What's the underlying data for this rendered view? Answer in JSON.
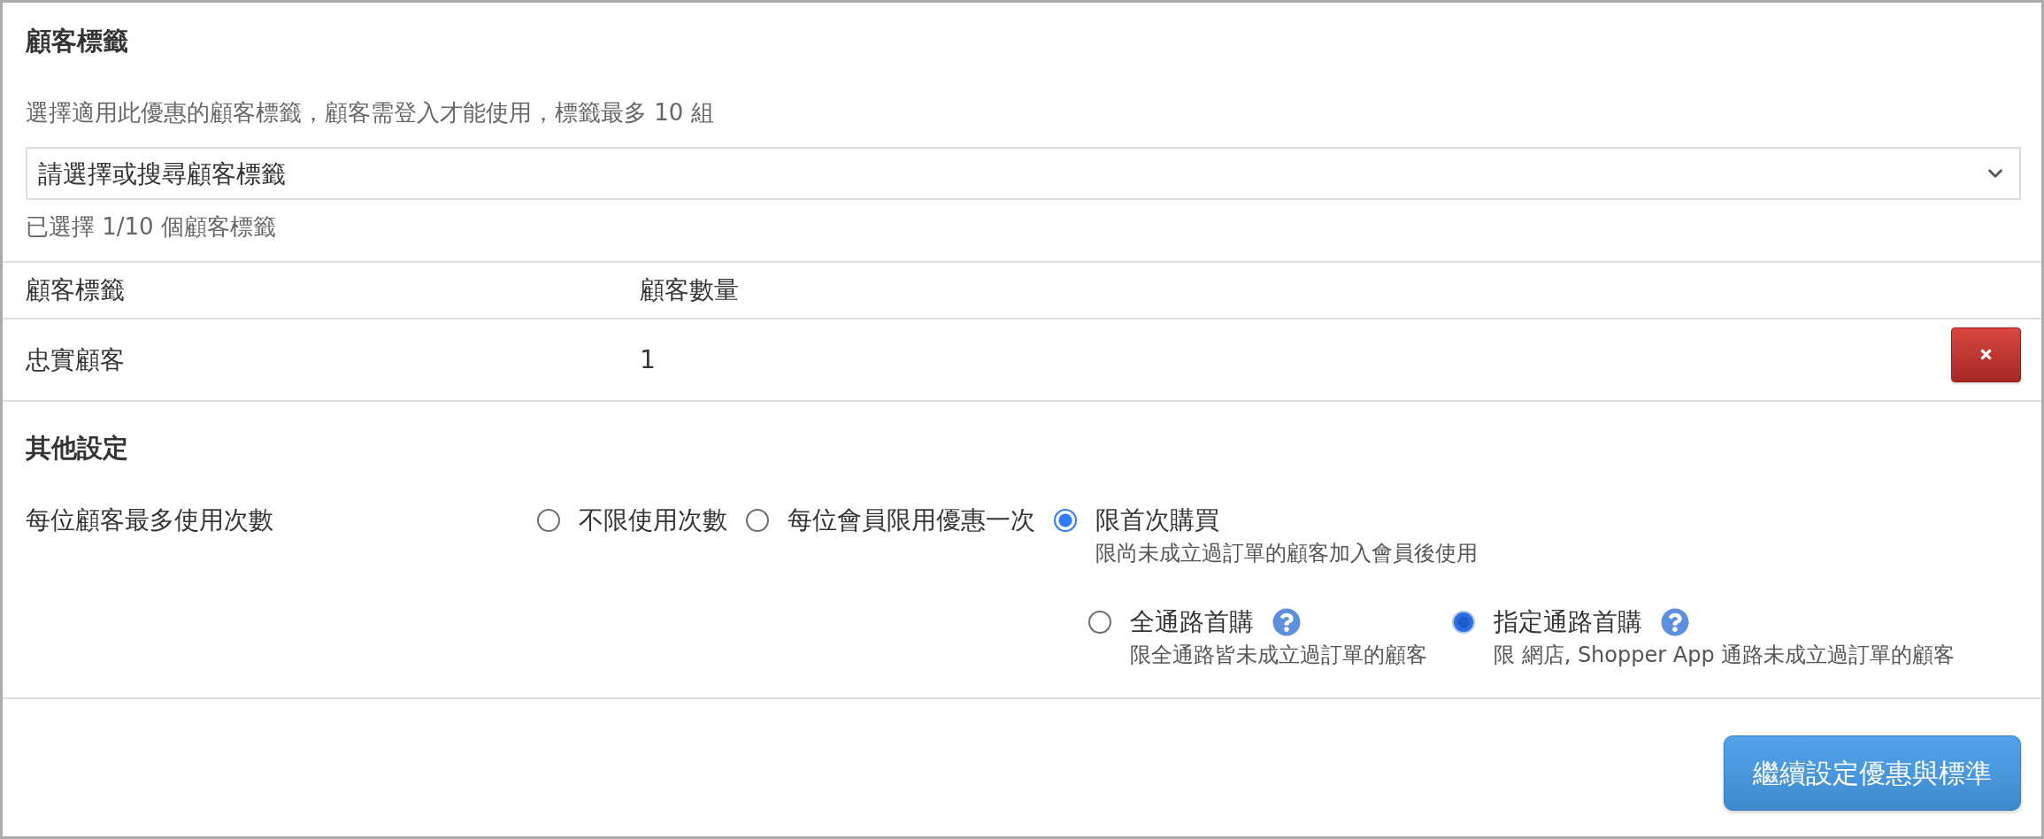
{
  "customer_tags": {
    "title": "顧客標籤",
    "description": "選擇適用此優惠的顧客標籤，顧客需登入才能使用，標籤最多 10 組",
    "select": {
      "placeholder": "請選擇或搜尋顧客標籤"
    },
    "selected_count": "已選擇 1/10 個顧客標籤",
    "table": {
      "columns": [
        "顧客標籤",
        "顧客數量"
      ],
      "rows": [
        {
          "cells": [
            "忠實顧客",
            "1"
          ]
        }
      ]
    }
  },
  "other_settings": {
    "title": "其他設定",
    "usage_limit": {
      "label": "每位顧客最多使用次數",
      "options": [
        {
          "label": "不限使用次數",
          "selected": false
        },
        {
          "label": "每位會員限用優惠一次",
          "selected": false
        },
        {
          "label": "限首次購買",
          "selected": true,
          "description": "限尚未成立過訂單的顧客加入會員後使用",
          "sub_options": [
            {
              "label": "全通路首購",
              "selected": false,
              "description": "限全通路皆未成立過訂單的顧客"
            },
            {
              "label": "指定通路首購",
              "selected": true,
              "description": "限 網店, Shopper App 通路未成立過訂單的顧客"
            }
          ]
        }
      ]
    }
  },
  "footer": {
    "button": "繼續設定優惠與標準"
  }
}
